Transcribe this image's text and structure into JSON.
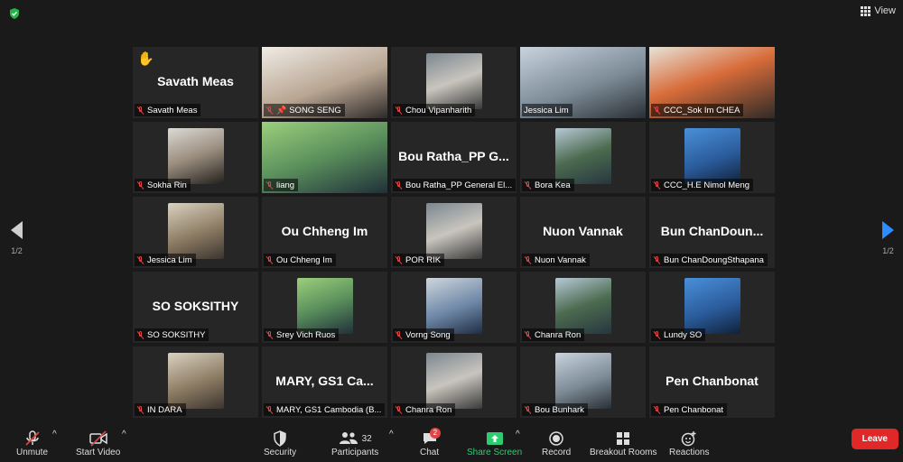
{
  "header": {
    "view_label": "View"
  },
  "pager": {
    "left_page": "1/2",
    "right_page": "1/2"
  },
  "participants": [
    {
      "name": "Savath Meas",
      "big_name": "Savath Meas",
      "hand": "✋",
      "video": false
    },
    {
      "name": "SONG SENG",
      "video": true,
      "pinned": true
    },
    {
      "name": "Chou Vipanharith",
      "video": true
    },
    {
      "name": "Jessica Lim",
      "video": true,
      "active": true,
      "unmuted": true
    },
    {
      "name": "CCC_Sok Im CHEA",
      "video": true
    },
    {
      "name": "Sokha Rin",
      "video": true
    },
    {
      "name": "liang",
      "video": true
    },
    {
      "name": "Bou Ratha_PP General El...",
      "big_name": "Bou Ratha_PP G...",
      "video": false
    },
    {
      "name": "Bora Kea",
      "video": true
    },
    {
      "name": "CCC_H.E Nimol Meng",
      "video": true
    },
    {
      "name": "Jessica Lim",
      "video": true
    },
    {
      "name": "Ou Chheng Im",
      "big_name": "Ou Chheng Im",
      "video": false
    },
    {
      "name": "POR RIK",
      "video": true
    },
    {
      "name": "Nuon Vannak",
      "big_name": "Nuon Vannak",
      "video": false
    },
    {
      "name": "Bun ChanDoungSthapana",
      "big_name": "Bun ChanDoun...",
      "video": false
    },
    {
      "name": "SO SOKSITHY",
      "big_name": "SO SOKSITHY",
      "video": false
    },
    {
      "name": "Srey Vich Ruos",
      "video": true
    },
    {
      "name": "Vorng Song",
      "video": true
    },
    {
      "name": "Chanra Ron",
      "video": true
    },
    {
      "name": "Lundy SO",
      "video": true
    },
    {
      "name": "IN DARA",
      "video": true
    },
    {
      "name": "MARY, GS1 Cambodia (B...",
      "big_name": "MARY, GS1 Ca...",
      "video": false
    },
    {
      "name": "Chanra Ron",
      "video": true
    },
    {
      "name": "Bou Bunhark",
      "video": true
    },
    {
      "name": "Pen Chanbonat",
      "big_name": "Pen Chanbonat",
      "video": false
    }
  ],
  "toolbar": {
    "unmute": "Unmute",
    "start_video": "Start Video",
    "security": "Security",
    "participants": "Participants",
    "participant_count": "32",
    "chat": "Chat",
    "chat_badge": "2",
    "share_screen": "Share Screen",
    "record": "Record",
    "breakout_rooms": "Breakout Rooms",
    "reactions": "Reactions",
    "leave": "Leave",
    "caret": "^"
  },
  "colors": {
    "accent": "#2d8cff",
    "leave": "#e02828",
    "share": "#2ecc71",
    "active_speaker": "#c8dc3c"
  }
}
